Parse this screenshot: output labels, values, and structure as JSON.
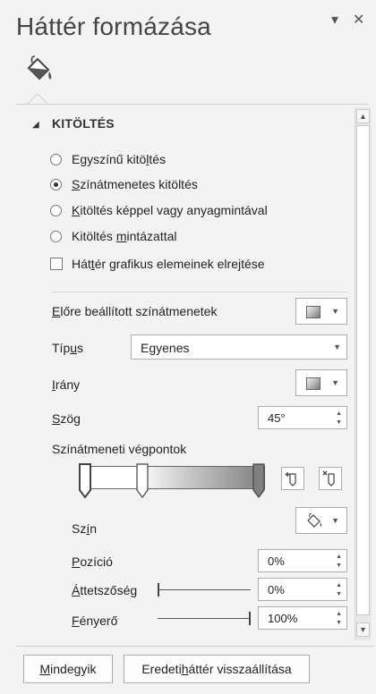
{
  "panel": {
    "title": "Háttér formázása",
    "pin_symbol": "▾",
    "close_symbol": "✕",
    "tab_icon": "paint-bucket-icon"
  },
  "section": {
    "label": "KITÖLTÉS",
    "expanded": true
  },
  "fill_options": [
    {
      "pre": "Egyszínű kitö",
      "u": "l",
      "post": "tés",
      "checked": false
    },
    {
      "pre": "",
      "u": "S",
      "post": "zínátmenetes kitöltés",
      "checked": true
    },
    {
      "pre": "",
      "u": "K",
      "post": "itöltés képpel vagy anyagmintával",
      "checked": false
    },
    {
      "pre": "Kitöltés ",
      "u": "m",
      "post": "intázattal",
      "checked": false
    }
  ],
  "hide_background": {
    "pre": "Hát",
    "u": "t",
    "post": "ér grafikus elemeinek elrejtése",
    "checked": false
  },
  "preset": {
    "pre": "",
    "u": "E",
    "post": "lőre beállított színátmenetek",
    "icon": "gradient-swatch-icon"
  },
  "type": {
    "pre": "Típ",
    "u": "u",
    "post": "s",
    "value": "Egyenes"
  },
  "direction": {
    "pre": "",
    "u": "I",
    "post": "rány",
    "icon": "gradient-swatch-icon"
  },
  "angle": {
    "pre": "",
    "u": "S",
    "post": "zög",
    "value": "45°"
  },
  "stops_label": "Színátmeneti végpontok",
  "gradient_stops": [
    {
      "position": 0,
      "selected": true
    },
    {
      "position": 0.33,
      "selected": false
    },
    {
      "position": 1,
      "selected": false
    }
  ],
  "color": {
    "pre": "Sz",
    "u": "í",
    "post": "n",
    "icon": "paint-bucket-icon"
  },
  "position": {
    "pre": "",
    "u": "P",
    "post": "ozíció",
    "value": "0%"
  },
  "transparency": {
    "pre": "",
    "u": "Á",
    "post": "ttetszőség",
    "value": "0%",
    "level": 0
  },
  "brightness": {
    "pre": "",
    "u": "F",
    "post": "ényerő",
    "value": "100%",
    "level": 1
  },
  "footer": {
    "apply_all": {
      "pre": "",
      "u": "M",
      "post": "indegyik"
    },
    "reset": {
      "pre": "Eredeti ",
      "u": "h",
      "post": "áttér visszaállítása"
    }
  },
  "colors": {
    "accent": "#444444",
    "panel_bg": "#f3f3f3",
    "border": "#adadad"
  }
}
